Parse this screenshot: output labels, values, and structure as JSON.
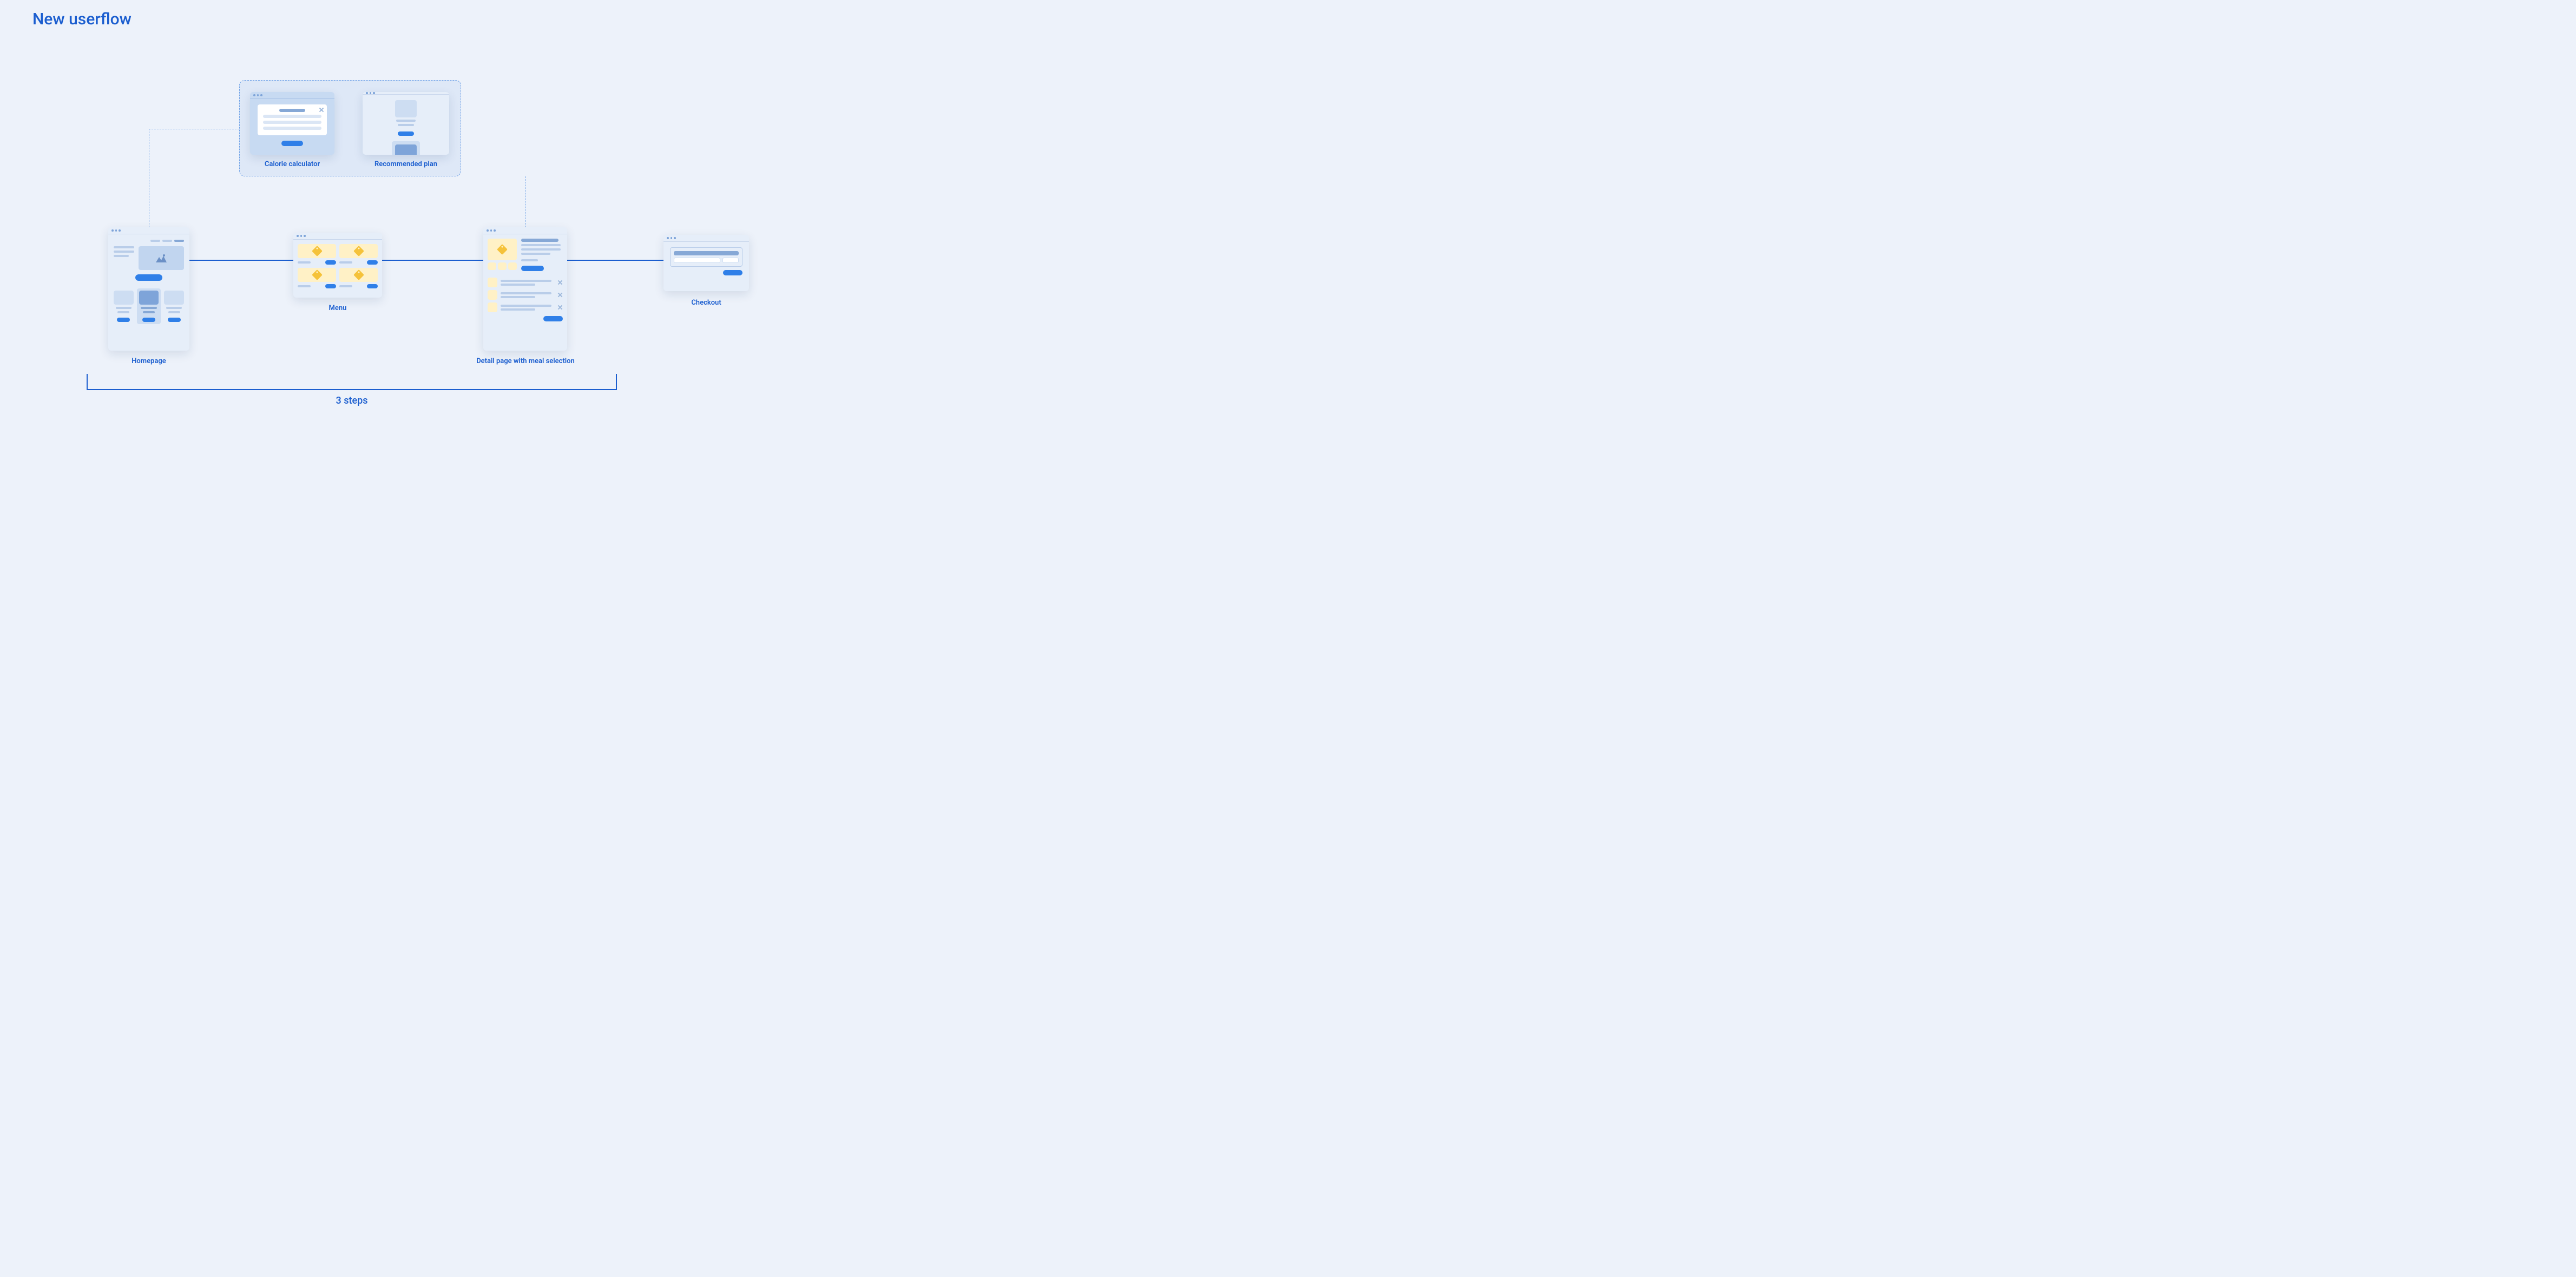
{
  "title": "New userflow",
  "colors": {
    "accent": "#1b5ecf",
    "background": "#edf2fa",
    "card": "#e6eef9",
    "cardTinted": "#c7daf2",
    "highlight": "#f5c23a"
  },
  "optionalGroup": {
    "items": [
      {
        "label": "Calorie calculator"
      },
      {
        "label": "Recommended plan"
      }
    ]
  },
  "flow": {
    "steps": [
      {
        "id": "homepage",
        "label": "Homepage"
      },
      {
        "id": "menu",
        "label": "Menu"
      },
      {
        "id": "detail",
        "label": "Detail page with meal selection"
      },
      {
        "id": "checkout",
        "label": "Checkout"
      }
    ],
    "bracket": {
      "label": "3 steps",
      "covers": [
        "homepage",
        "menu",
        "detail"
      ]
    }
  }
}
